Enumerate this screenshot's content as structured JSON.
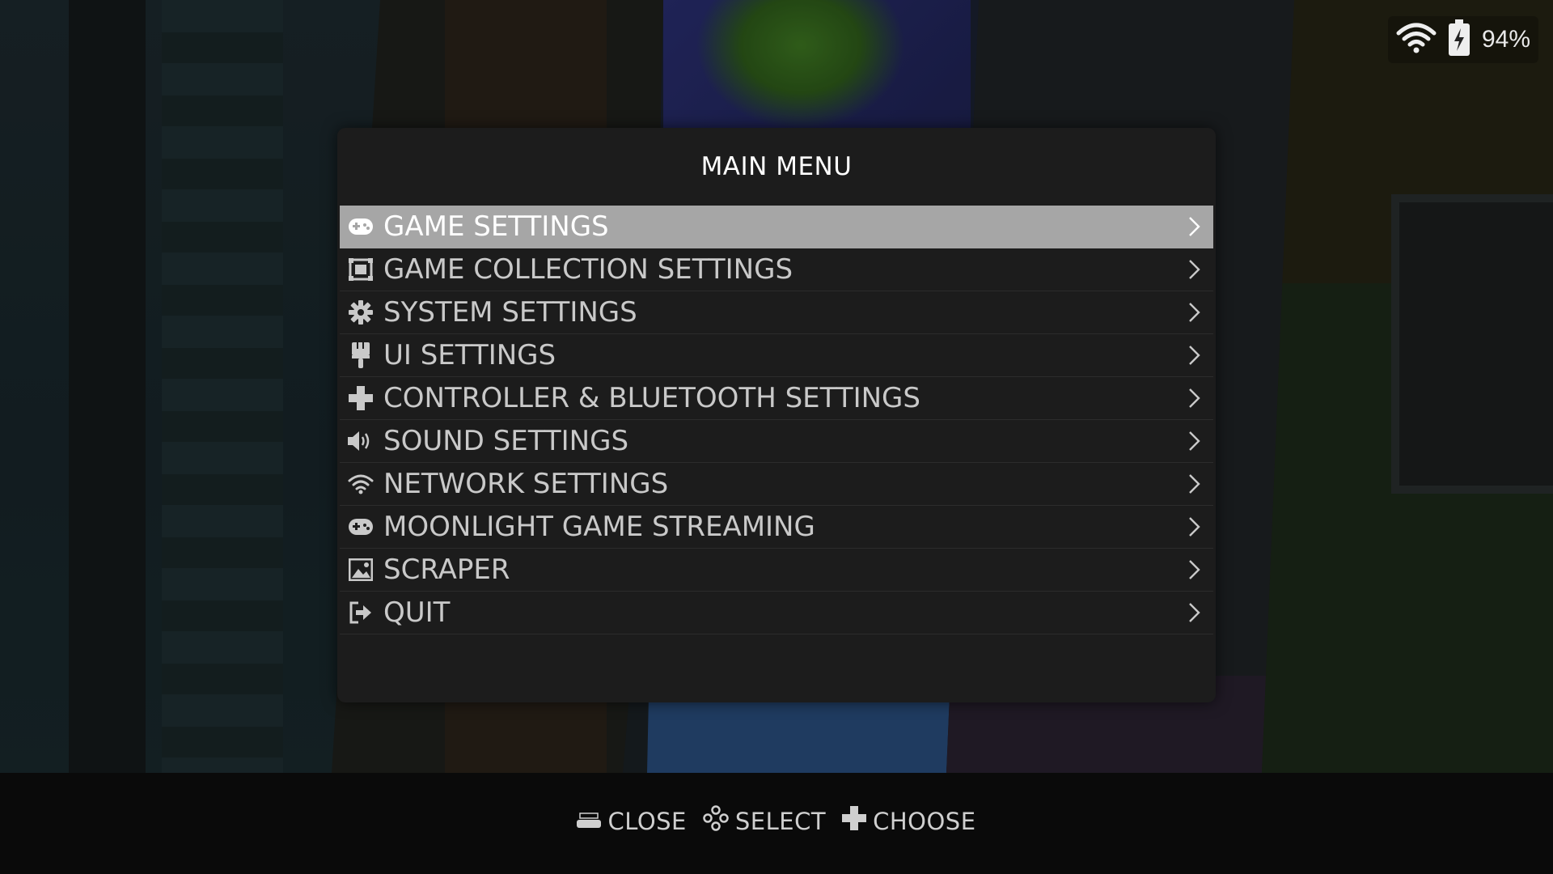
{
  "status": {
    "battery_percent": "94%",
    "wifi_icon": "wifi-icon",
    "battery_icon": "battery-charging-icon"
  },
  "menu": {
    "title": "MAIN MENU",
    "items": [
      {
        "label": "GAME SETTINGS",
        "icon": "gamepad-icon",
        "selected": true
      },
      {
        "label": "GAME COLLECTION SETTINGS",
        "icon": "collection-icon"
      },
      {
        "label": "SYSTEM SETTINGS",
        "icon": "gear-icon"
      },
      {
        "label": "UI SETTINGS",
        "icon": "brush-icon"
      },
      {
        "label": "CONTROLLER & BLUETOOTH SETTINGS",
        "icon": "dpad-icon"
      },
      {
        "label": "SOUND SETTINGS",
        "icon": "speaker-icon"
      },
      {
        "label": "NETWORK SETTINGS",
        "icon": "wifi-icon"
      },
      {
        "label": "MOONLIGHT GAME STREAMING",
        "icon": "gamepad-icon"
      },
      {
        "label": "SCRAPER",
        "icon": "image-icon"
      },
      {
        "label": "QUIT",
        "icon": "exit-icon"
      }
    ]
  },
  "footer": {
    "hints": [
      {
        "label": "CLOSE",
        "icon": "start-button-icon"
      },
      {
        "label": "SELECT",
        "icon": "face-buttons-icon"
      },
      {
        "label": "CHOOSE",
        "icon": "dpad-icon"
      }
    ]
  },
  "colors": {
    "menu_bg": "#1c1c1c",
    "selected_bg": "#a6a6a6",
    "text": "#c9c9c9"
  }
}
